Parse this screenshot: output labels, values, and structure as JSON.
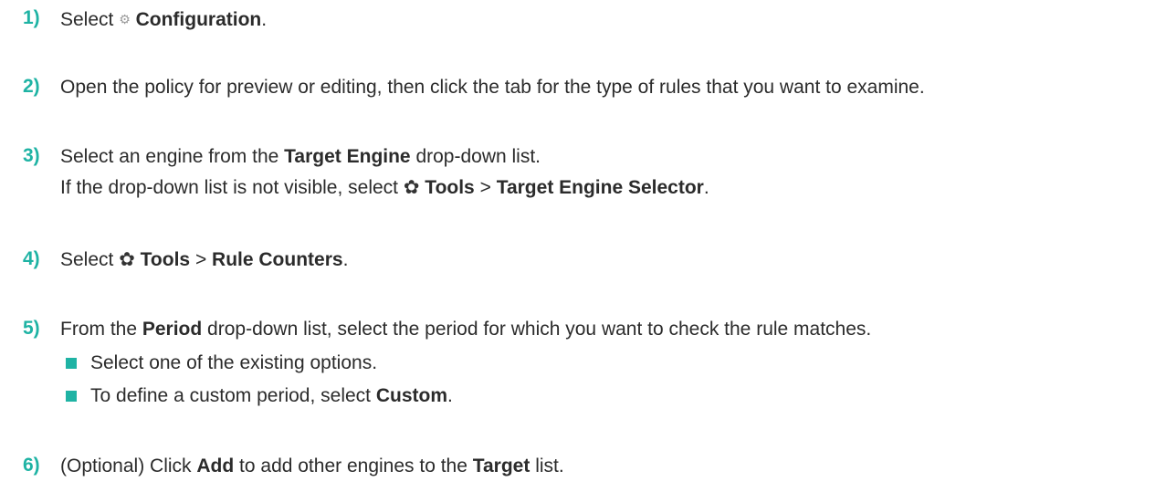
{
  "steps": [
    {
      "num": "1)",
      "pre": "Select ",
      "icon": "gears-icon",
      "icon_glyph": "⚙",
      "bold": "Configuration",
      "post": "."
    },
    {
      "num": "2)",
      "text": "Open the policy for preview or editing, then click the tab for the type of rules that you want to examine."
    },
    {
      "num": "3)",
      "pre": "Select an engine from the ",
      "bold": "Target Engine",
      "post": " drop-down list.",
      "line2": {
        "pre": "If the drop-down list is not visible, select ",
        "icon": "gear-icon",
        "icon_glyph": "✿",
        "bold1": "Tools",
        "sep": " > ",
        "bold2": "Target Engine Selector",
        "post": "."
      }
    },
    {
      "num": "4)",
      "pre": "Select ",
      "icon": "gear-icon",
      "icon_glyph": "✿",
      "bold1": "Tools",
      "sep": " > ",
      "bold2": "Rule Counters",
      "post": "."
    },
    {
      "num": "5)",
      "pre": "From the ",
      "bold": "Period",
      "post": " drop-down list, select the period for which you want to check the rule matches.",
      "bullets": [
        {
          "text": "Select one of the existing options."
        },
        {
          "pre": "To define a custom period, select ",
          "bold": "Custom",
          "post": "."
        }
      ]
    },
    {
      "num": "6)",
      "pre": "(Optional) Click ",
      "bold1": "Add",
      "mid": " to add other engines to the ",
      "bold2": "Target",
      "post": " list."
    }
  ],
  "colors": {
    "accent": "#1fb3a4",
    "text": "#2b2b2b"
  }
}
